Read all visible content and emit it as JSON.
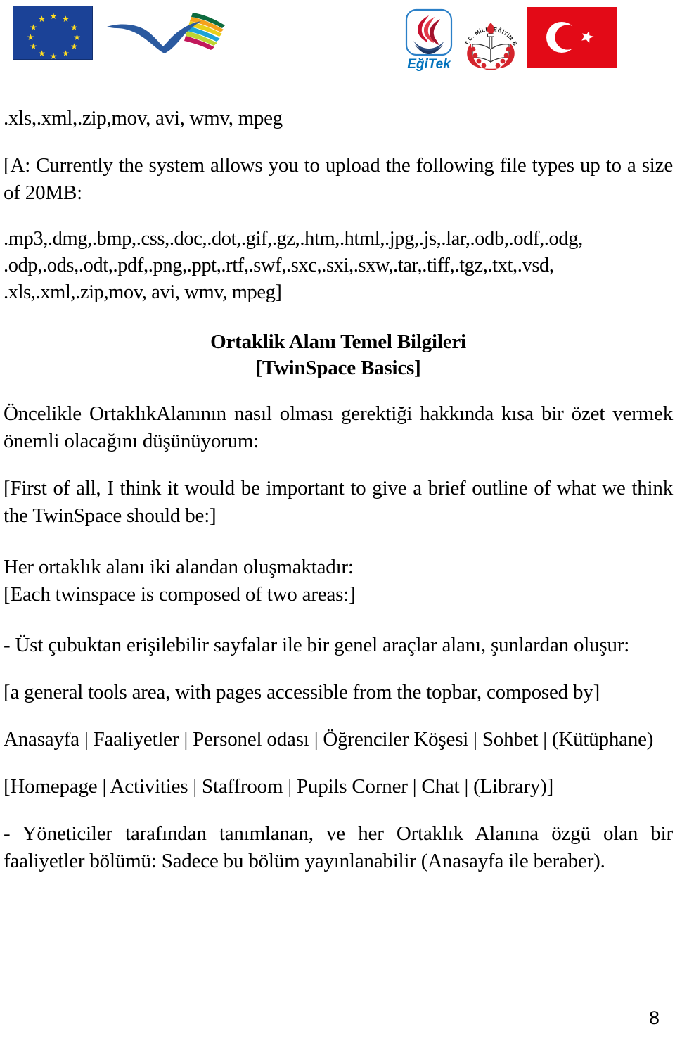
{
  "header": {
    "logos": [
      {
        "name": "european-union-flag",
        "label": "European Union Flag",
        "colors": {
          "field": "#1b4297",
          "stars": "#ffdd22"
        }
      },
      {
        "name": "lifelong-learning-programme-logo",
        "label": "Lifelong Learning Programme"
      },
      {
        "name": "egitek-logo",
        "label": "EğiTek",
        "text": "EğiTek",
        "colors": {
          "flame": "#c8102e",
          "book": "#2b4b7d",
          "text": "#0071bc"
        }
      },
      {
        "name": "meb-seal",
        "label": "T.C. MİLLİ EĞİTİM BAKANLIĞI",
        "text": "T.C. MİLLİ EĞİTİM BAKANLIĞI",
        "colors": {
          "wreath": "#d4242c"
        }
      },
      {
        "name": "turkish-flag",
        "label": "Turkish Flag",
        "colors": {
          "field": "#e30a17",
          "emblem": "#ffffff"
        }
      }
    ]
  },
  "content": {
    "filetypes_line_top": ".xls,.xml,.zip,mov, avi, wmv, mpeg",
    "answer_paragraph": "[A: Currently the system allows you to upload the following file types up to a size of 20MB:",
    "filetypes_block": [
      ".mp3,.dmg,.bmp,.css,.doc,.dot,.gif,.gz,.htm,.html,.jpg,.js,.lar,.odb,.odf,.odg,",
      ".odp,.ods,.odt,.pdf,.png,.ppt,.rtf,.swf,.sxc,.sxi,.sxw,.tar,.tiff,.tgz,.txt,.vsd,",
      ".xls,.xml,.zip,mov, avi, wmv, mpeg]"
    ],
    "heading_tr": "Ortaklik Alanı Temel Bilgileri",
    "heading_en": "[TwinSpace Basics]",
    "intro_tr": "Öncelikle OrtaklıkAlanının nasıl olması gerektiği hakkında kısa bir özet vermek önemli olacağını düşünüyorum:",
    "intro_en": "[First of all, I think it would be important to give a brief outline of what we think the TwinSpace should be:]",
    "composed_tr": "Her ortaklık alanı iki alandan oluşmaktadır:",
    "composed_en": "[Each twinspace is composed of two areas:]",
    "area1_tr": "- Üst çubuktan erişilebilir sayfalar ile bir genel araçlar alanı, şunlardan oluşur:",
    "area1_en": "[a general tools area, with pages accessible from the topbar, composed by]",
    "nav_tr": "Anasayfa | Faaliyetler | Personel odası | Öğrenciler Köşesi | Sohbet | (Kütüphane)",
    "nav_en": "[Homepage | Activities | Staffroom | Pupils Corner | Chat | (Library)]",
    "area2_tr": "- Yöneticiler tarafından tanımlanan, ve her Ortaklık Alanına özgü olan bir faaliyetler bölümü: Sadece bu bölüm yayınlanabilir (Anasayfa ile beraber)."
  },
  "footer": {
    "page_number": "8"
  }
}
